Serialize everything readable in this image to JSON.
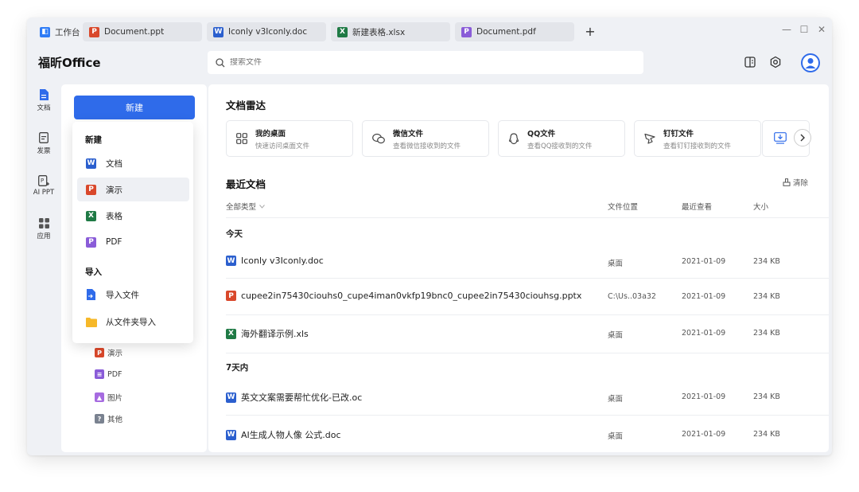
{
  "tabs": [
    {
      "label": "工作台",
      "icon": "home-icon"
    },
    {
      "label": "Document.ppt",
      "icon": "P"
    },
    {
      "label": "Iconly v3Iconly.doc",
      "icon": "W"
    },
    {
      "label": "新建表格.xlsx",
      "icon": "X"
    },
    {
      "label": "Document.pdf",
      "icon": "P"
    }
  ],
  "tab_add": "+",
  "window_controls": {
    "minimize": "—",
    "maximize": "☐",
    "close": "✕"
  },
  "brand": "福昕Office",
  "search": {
    "placeholder": "搜索文件"
  },
  "rail": [
    {
      "label": "文档"
    },
    {
      "label": "发票"
    },
    {
      "label": "AI PPT"
    },
    {
      "label": "应用"
    }
  ],
  "side": {
    "new_label": "新建",
    "sub_items": [
      {
        "label": "演示",
        "icon": "P"
      },
      {
        "label": "PDF",
        "icon": "P"
      },
      {
        "label": "图片",
        "icon": "image"
      },
      {
        "label": "其他",
        "icon": "?"
      }
    ]
  },
  "dropdown": {
    "new_heading": "新建",
    "new_items": [
      {
        "label": "文档",
        "icon": "W"
      },
      {
        "label": "演示",
        "icon": "P"
      },
      {
        "label": "表格",
        "icon": "X"
      },
      {
        "label": "PDF",
        "icon": "P"
      }
    ],
    "import_heading": "导入",
    "import_items": [
      {
        "label": "导入文件"
      },
      {
        "label": "从文件夹导入"
      }
    ]
  },
  "radar": {
    "title": "文档雷达",
    "cards": [
      {
        "title": "我的桌面",
        "desc": "快速访问桌面文件"
      },
      {
        "title": "微信文件",
        "desc": "查看微信接收到的文件"
      },
      {
        "title": "QQ文件",
        "desc": "查看QQ接收到的文件"
      },
      {
        "title": "钉钉文件",
        "desc": "查看钉钉接收到的文件"
      }
    ]
  },
  "recent": {
    "title": "最近文档",
    "clear_label": "清除",
    "columns": {
      "type": "全部类型",
      "location": "文件位置",
      "viewed": "最近查看",
      "size": "大小"
    },
    "groups": [
      {
        "label": "今天",
        "rows": [
          {
            "name": "Iconly v3Iconly.doc",
            "icon": "W",
            "location": "桌面",
            "date": "2021-01-09",
            "size": "234 KB"
          },
          {
            "name": "cupee2in75430ciouhs0_cupe4iman0vkfp19bnc0_cupee2in75430ciouhsg.pptx",
            "icon": "P",
            "location": "C:\\Us..03a32",
            "date": "2021-01-09",
            "size": "234 KB"
          },
          {
            "name": "海外翻译示例.xls",
            "icon": "X",
            "location": "桌面",
            "date": "2021-01-09",
            "size": "234 KB"
          }
        ]
      },
      {
        "label": "7天内",
        "rows": [
          {
            "name": "英文文案需要帮忙优化-已改.oc",
            "icon": "W",
            "location": "桌面",
            "date": "2021-01-09",
            "size": "234 KB"
          },
          {
            "name": "AI生成人物人像 公式.doc",
            "icon": "W",
            "location": "桌面",
            "date": "2021-01-09",
            "size": "234 KB"
          }
        ]
      }
    ]
  },
  "colors": {
    "accent": "#2f6bea",
    "word": "#2b5fce",
    "ppt": "#d9482b",
    "excel": "#1f7a45",
    "pdf": "#8a5cd8"
  }
}
